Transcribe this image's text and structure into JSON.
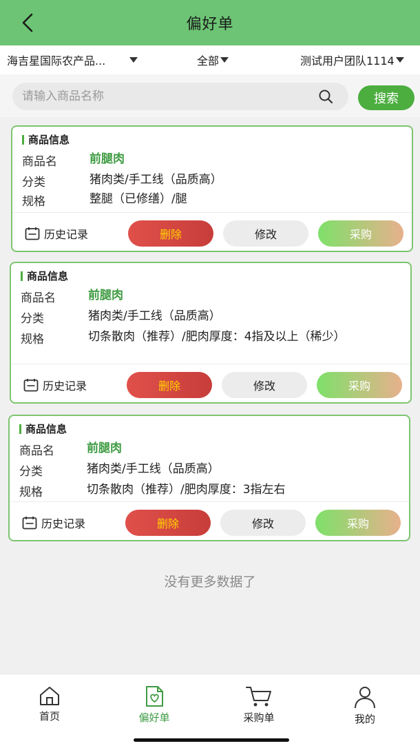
{
  "header": {
    "title": "偏好单"
  },
  "filters": {
    "market": "海吉星国际农产品...",
    "category": "全部",
    "team": "测试用户团队1114"
  },
  "search": {
    "placeholder": "请输入商品名称",
    "value": "",
    "button": "搜索"
  },
  "card_labels": {
    "section": "商品信息",
    "name": "商品名",
    "category": "分类",
    "spec": "规格",
    "history": "历史记录",
    "delete": "删除",
    "edit": "修改",
    "buy": "采购"
  },
  "items": [
    {
      "name": "前腿肉",
      "category": "猪肉类/手工线（品质高）",
      "spec": "整腿（已修缮）/腿"
    },
    {
      "name": "前腿肉",
      "category": "猪肉类/手工线（品质高）",
      "spec": "切条散肉（推荐）/肥肉厚度：4指及以上（稀少）"
    },
    {
      "name": "前腿肉",
      "category": "猪肉类/手工线（品质高）",
      "spec": "切条散肉（推荐）/肥肉厚度：3指左右"
    }
  ],
  "footer_text": "没有更多数据了",
  "tabbar": {
    "items": [
      {
        "label": "首页",
        "icon": "home-icon"
      },
      {
        "label": "偏好单",
        "icon": "favorite-list-icon"
      },
      {
        "label": "采购单",
        "icon": "cart-icon"
      },
      {
        "label": "我的",
        "icon": "user-icon"
      }
    ],
    "active": "偏好单"
  },
  "colors": {
    "header_bg": "#6cc474",
    "accent": "#4cae3f",
    "delete": "#d9443f"
  }
}
